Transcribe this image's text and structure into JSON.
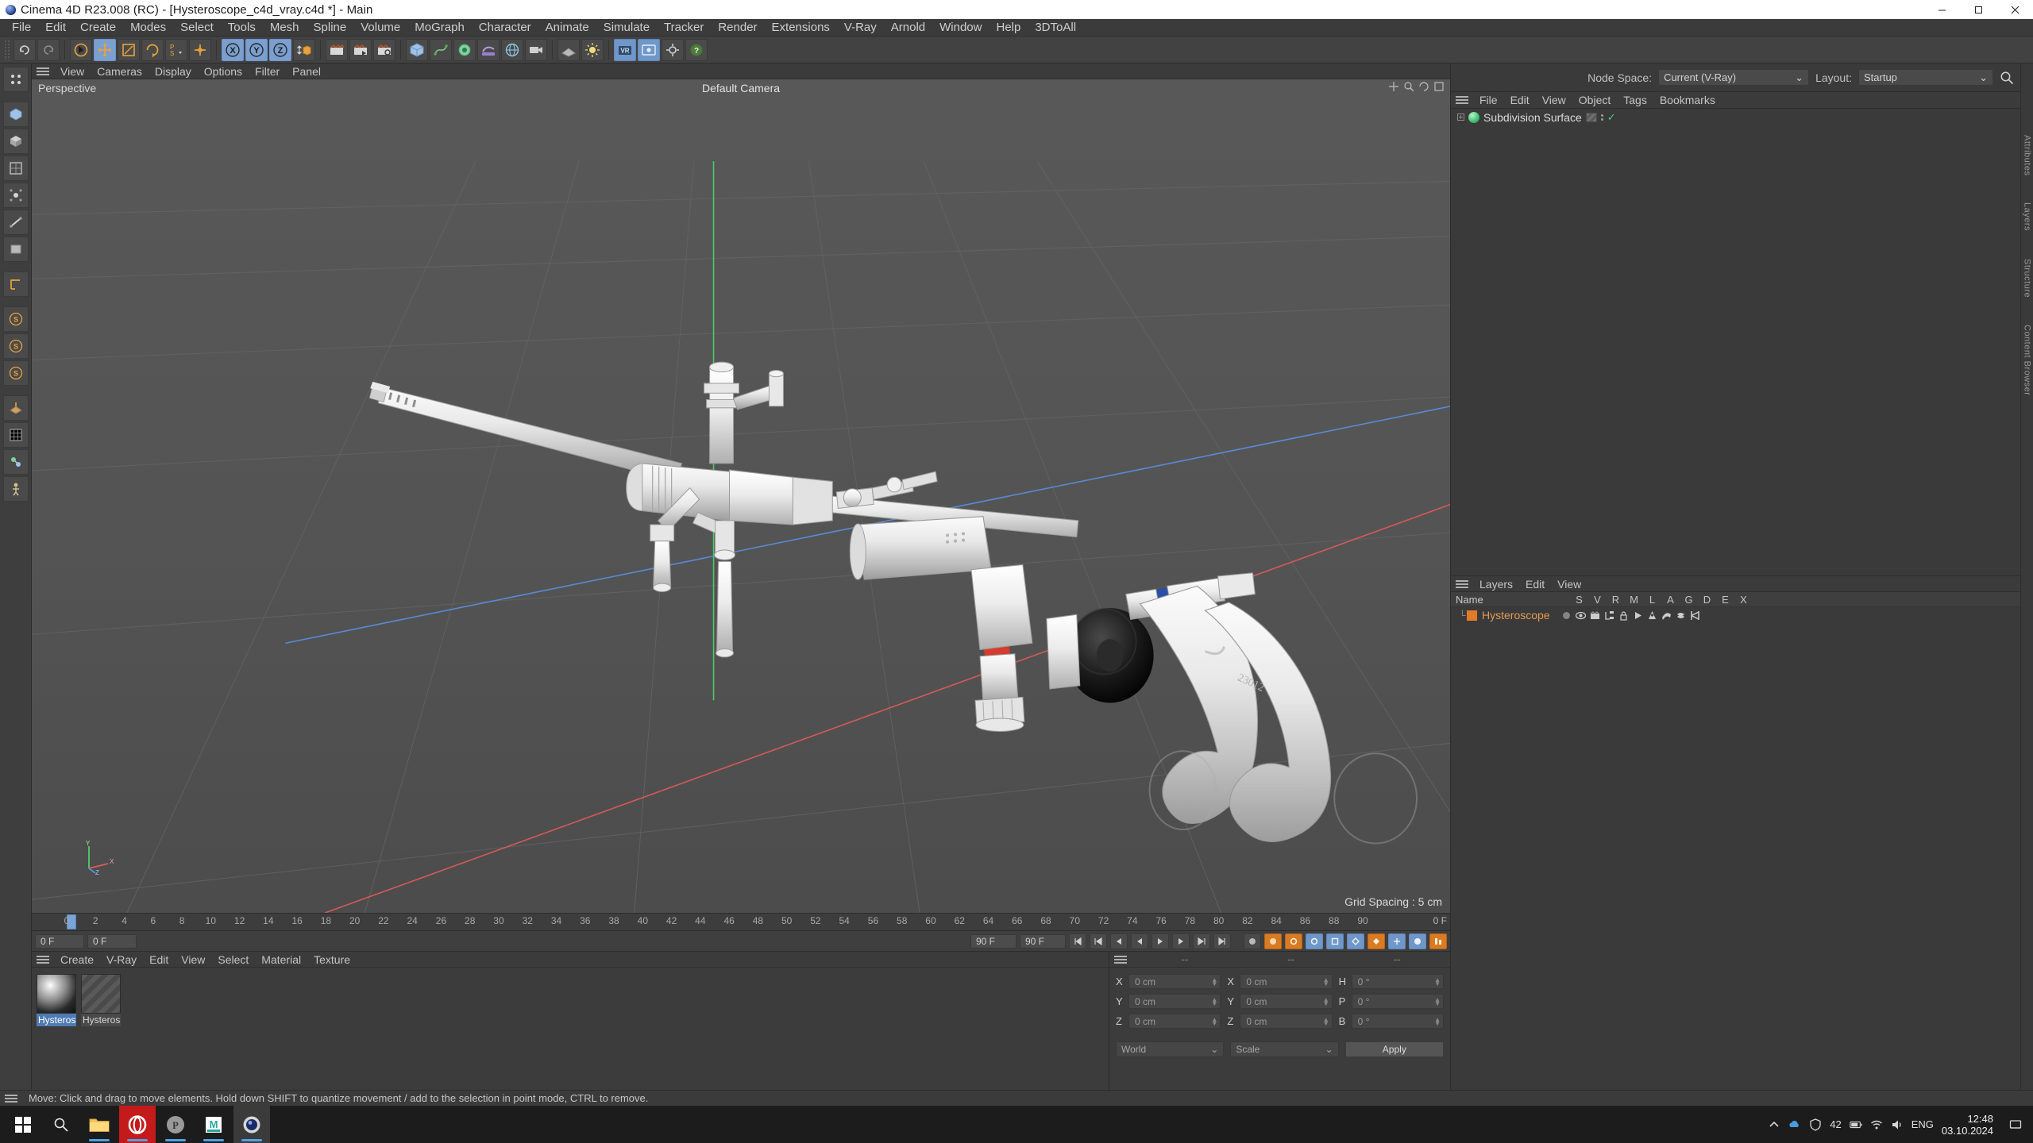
{
  "window": {
    "title": "Cinema 4D R23.008 (RC) - [Hysteroscope_c4d_vray.c4d *] - Main",
    "minimize": "—",
    "maximize": "▢",
    "close": "✕"
  },
  "menubar": {
    "items": [
      "File",
      "Edit",
      "Create",
      "Modes",
      "Select",
      "Tools",
      "Mesh",
      "Spline",
      "Volume",
      "MoGraph",
      "Character",
      "Animate",
      "Simulate",
      "Tracker",
      "Render",
      "Extensions",
      "V-Ray",
      "Arnold",
      "Window",
      "Help",
      "3DToAll"
    ]
  },
  "header_right": {
    "node_space_label": "Node Space:",
    "node_space_value": "Current (V-Ray)",
    "layout_label": "Layout:",
    "layout_value": "Startup",
    "search_icon": "search-icon"
  },
  "viewport_menu": {
    "items": [
      "View",
      "Cameras",
      "Display",
      "Options",
      "Filter",
      "Panel"
    ]
  },
  "viewport": {
    "mode_label": "Perspective",
    "camera_label": "Default Camera",
    "grid_spacing": "Grid Spacing : 5 cm",
    "axis_labels": {
      "y": "Y",
      "x": "X",
      "z": "Z"
    }
  },
  "timeline": {
    "ticks": [
      "0",
      "2",
      "4",
      "6",
      "8",
      "10",
      "12",
      "14",
      "16",
      "18",
      "20",
      "22",
      "24",
      "26",
      "28",
      "30",
      "32",
      "34",
      "36",
      "38",
      "40",
      "42",
      "44",
      "46",
      "48",
      "50",
      "52",
      "54",
      "56",
      "58",
      "60",
      "62",
      "64",
      "66",
      "68",
      "70",
      "72",
      "74",
      "76",
      "78",
      "80",
      "82",
      "84",
      "86",
      "88",
      "90"
    ],
    "current_frame": "0 F",
    "playhead_frame": "0"
  },
  "transport": {
    "left_field": "0 F",
    "second_field": "0 F",
    "end_field": "90 F",
    "fps_field": "90 F",
    "buttons": [
      "go-to-start",
      "key-prev",
      "frame-prev",
      "play-reverse",
      "play",
      "frame-next",
      "key-next",
      "go-to-end"
    ]
  },
  "materials": {
    "menu": [
      "Create",
      "V-Ray",
      "Edit",
      "View",
      "Select",
      "Material",
      "Texture"
    ],
    "items": [
      {
        "name": "Hysteros",
        "selected": true,
        "thumb": "sphere"
      },
      {
        "name": "Hysteros",
        "selected": false,
        "thumb": "hatch"
      }
    ]
  },
  "coordinates": {
    "header": [
      "--",
      "--",
      "--"
    ],
    "rows": [
      {
        "pos_label": "X",
        "pos_value": "0 cm",
        "size_label": "X",
        "size_value": "0 cm",
        "rot_label": "H",
        "rot_value": "0 °"
      },
      {
        "pos_label": "Y",
        "pos_value": "0 cm",
        "size_label": "Y",
        "size_value": "0 cm",
        "rot_label": "P",
        "rot_value": "0 °"
      },
      {
        "pos_label": "Z",
        "pos_value": "0 cm",
        "size_label": "Z",
        "size_value": "0 cm",
        "rot_label": "B",
        "rot_value": "0 °"
      }
    ],
    "world_select": "World",
    "scale_select": "Scale",
    "apply_button": "Apply"
  },
  "object_manager": {
    "menu": [
      "File",
      "Edit",
      "View",
      "Object",
      "Tags",
      "Bookmarks"
    ],
    "objects": [
      {
        "name": "Subdivision Surface",
        "expandable": true,
        "visible_check": "✓"
      }
    ]
  },
  "layers": {
    "menu": [
      "Layers",
      "Edit",
      "View"
    ],
    "columns": [
      "Name",
      "S",
      "V",
      "R",
      "M",
      "L",
      "A",
      "G",
      "D",
      "E",
      "X"
    ],
    "rows": [
      {
        "name": "Hysteroscope",
        "color": "#e07b2a"
      }
    ]
  },
  "rail": {
    "labels": [
      "Attributes",
      "Layers",
      "Structure",
      "Content Browser"
    ]
  },
  "statusbar": {
    "message": "Move: Click and drag to move elements. Hold down SHIFT to quantize movement / add to the selection in point mode, CTRL to remove."
  },
  "taskbar": {
    "start": "windows-logo",
    "search": "search-icon",
    "apps": [
      "file-explorer",
      "opera-browser",
      "pdf-app",
      "maya-app",
      "cinema4d-app"
    ],
    "tray": {
      "volume_badge": "42",
      "language": "ENG",
      "time": "12:48",
      "date": "03.10.2024"
    }
  },
  "colors": {
    "accent_blue": "#6f97c9",
    "orange": "#d97b22",
    "layer_orange": "#e07b2a",
    "green": "#3fbf70",
    "viewport_bg": "#545454"
  }
}
